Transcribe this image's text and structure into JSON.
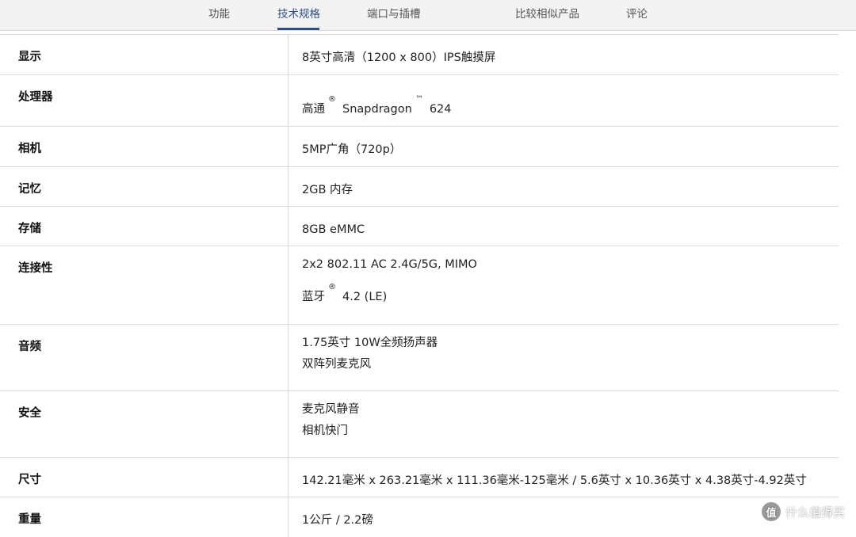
{
  "tabs": [
    {
      "label": "功能",
      "active": false
    },
    {
      "label": "技术规格",
      "active": true
    },
    {
      "label": "端口与插槽",
      "active": false
    },
    {
      "label": "比较相似产品",
      "active": false
    },
    {
      "label": "评论",
      "active": false
    }
  ],
  "accent_color": "#2e4f86",
  "specs": {
    "display": {
      "label": "显示",
      "value": "8英寸高清（1200 x 800）IPS触摸屏"
    },
    "processor": {
      "label": "处理器",
      "brand": "高通",
      "reg": "®",
      "name": "Snapdragon",
      "tm": "™",
      "model": "624"
    },
    "camera": {
      "label": "相机",
      "value": "5MP广角（720p）"
    },
    "memory": {
      "label": "记忆",
      "value": "2GB 内存"
    },
    "storage": {
      "label": "存储",
      "value": "8GB eMMC"
    },
    "connectivity": {
      "label": "连接性",
      "line1": "2x2 802.11 AC 2.4G/5G, MIMO",
      "bt_name": "蓝牙",
      "bt_reg": "®",
      "bt_version": "4.2 (LE)"
    },
    "audio": {
      "label": "音频",
      "line1": "1.75英寸 10W全频扬声器",
      "line2": "双阵列麦克风"
    },
    "security": {
      "label": "安全",
      "line1": "麦克风静音",
      "line2": "相机快门"
    },
    "dimensions": {
      "label": "尺寸",
      "value": "142.21毫米 x 263.21毫米 x 111.36毫米-125毫米 / 5.6英寸 x 10.36英寸 x 4.38英寸-4.92英寸"
    },
    "weight": {
      "label": "重量",
      "value": "1公斤 / 2.2磅"
    }
  },
  "watermark": {
    "logo": "值",
    "text": "什么值得买"
  }
}
